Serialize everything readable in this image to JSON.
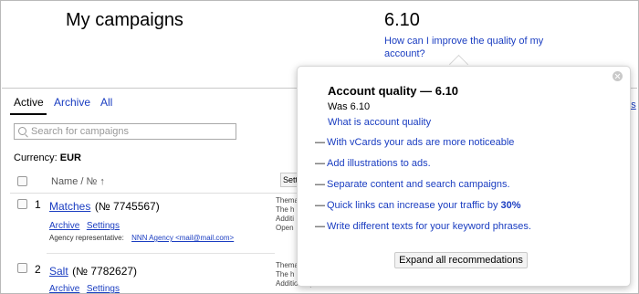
{
  "header": {
    "title": "My campaigns",
    "quality_score": "6.10",
    "improve_link": "How can I improve the quality of my account?"
  },
  "tabs": [
    {
      "label": "Active",
      "active": true
    },
    {
      "label": "Archive",
      "active": false
    },
    {
      "label": "All",
      "active": false
    }
  ],
  "search": {
    "placeholder": "Search for campaigns"
  },
  "currency": {
    "label": "Currency:",
    "value": "EUR"
  },
  "table": {
    "name_header": "Name / № ↑",
    "settings_header": "Setti",
    "rows": [
      {
        "num": "1",
        "name": "Matches",
        "id": "(№ 7745567)",
        "archive": "Archive",
        "settings": "Settings",
        "agency_label": "Agency representative:",
        "agency_value": "NNN Agency <mail@mail.com>",
        "side_lines": [
          "Thema",
          "The h",
          "Additi",
          "Open"
        ]
      },
      {
        "num": "2",
        "name": "Salt",
        "id": "(№ 7782627)",
        "archive": "Archive",
        "settings": "Settings",
        "side_lines": [
          "Thema",
          "The h",
          "Additional phrases"
        ]
      }
    ]
  },
  "right_cut_text": "ngs",
  "popup": {
    "title": "Account quality — 6.10",
    "was": "Was 6.10",
    "what_link": "What is account quality",
    "recommendations": [
      {
        "text": "With vCards your ads are more noticeable"
      },
      {
        "text": "Add illustrations to ads."
      },
      {
        "text": "Separate content and search campaigns."
      },
      {
        "text": "Quick links can increase your traffic by ",
        "bold": "30%"
      },
      {
        "text": "Write different texts for your keyword phrases."
      }
    ],
    "dash": "—",
    "expand_button": "Expand all recommedations"
  },
  "icons": {
    "search": "search-icon",
    "close": "close-icon"
  }
}
